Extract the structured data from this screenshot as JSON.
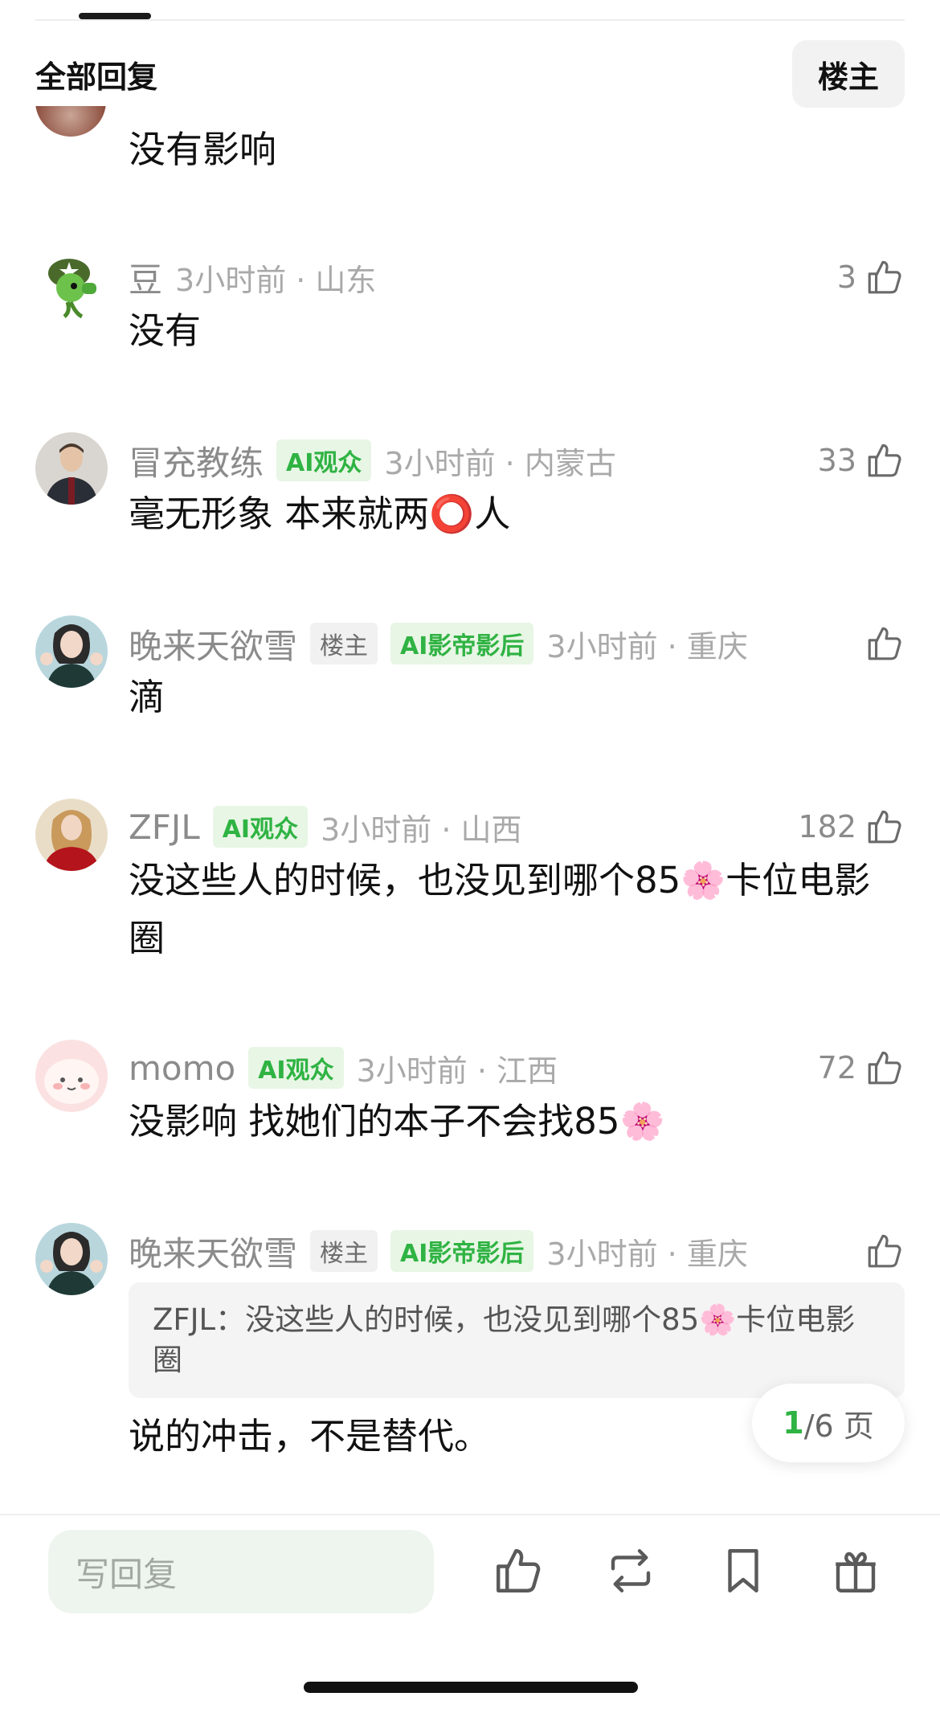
{
  "header": {
    "title": "全部回复",
    "filter_label": "楼主"
  },
  "partial_comment": {
    "text": "没有影响"
  },
  "comments": [
    {
      "username": "豆",
      "badges": [],
      "time_location": "3小时前 · 山东",
      "likes": "3",
      "text": "没有"
    },
    {
      "username": "冒充教练",
      "badges": [
        "AI观众"
      ],
      "time_location": "3小时前 · 内蒙古",
      "likes": "33",
      "text": "毫无形象 本来就两⭕人"
    },
    {
      "username": "晚来天欲雪",
      "owner_badge": "楼主",
      "badges": [
        "AI影帝影后"
      ],
      "time_location": "3小时前 · 重庆",
      "likes": "",
      "text": "滴"
    },
    {
      "username": "ZFJL",
      "badges": [
        "AI观众"
      ],
      "time_location": "3小时前 · 山西",
      "likes": "182",
      "text": "没这些人的时候，也没见到哪个85🌸卡位电影圈"
    },
    {
      "username": "momo",
      "badges": [
        "AI观众"
      ],
      "time_location": "3小时前 · 江西",
      "likes": "72",
      "text": "没影响 找她们的本子不会找85🌸"
    },
    {
      "username": "晚来天欲雪",
      "owner_badge": "楼主",
      "badges": [
        "AI影帝影后"
      ],
      "time_location": "3小时前 · 重庆",
      "likes": "",
      "quote": "ZFJL：没这些人的时候，也没见到哪个85🌸卡位电影圈",
      "text": "说的冲击，不是替代。"
    }
  ],
  "pager": {
    "current": "1",
    "total_suffix": "/6 页"
  },
  "bottom_bar": {
    "reply_placeholder": "写回复",
    "icons": [
      "thumbs-up-icon",
      "repost-icon",
      "bookmark-icon",
      "gift-icon"
    ]
  },
  "colors": {
    "accent_green": "#2fb343",
    "badge_green_bg": "#e8f6e5",
    "meta_gray": "#a9a9a9"
  }
}
